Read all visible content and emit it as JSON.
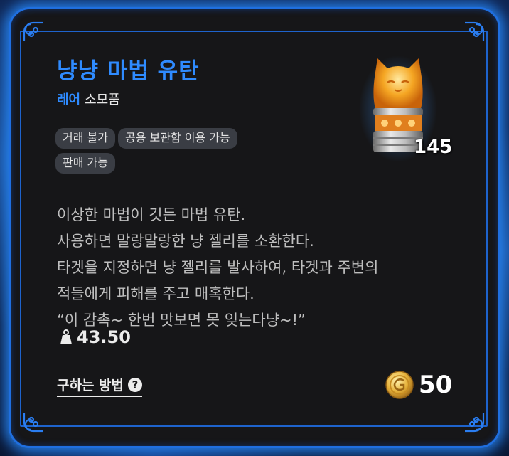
{
  "item": {
    "name": "냥냥 마법 유탄",
    "rarity": "레어",
    "category": "소모품",
    "count": "145",
    "icon": "cat-jelly-canister-icon"
  },
  "tags": [
    "거래 불가",
    "공용 보관함 이용 가능",
    "판매 가능"
  ],
  "description": [
    "이상한 마법이 깃든 마법 유탄.",
    "사용하면 말랑말랑한 냥 젤리를 소환한다.",
    "타겟을 지정하면 냥 젤리를 발사하여, 타겟과 주변의",
    "적들에게 피해를 주고 매혹한다.",
    "“이 감촉~ 한번 맛보면 못 잊는다냥~!”"
  ],
  "weight": "43.50",
  "how_to_obtain": "구하는 방법",
  "help_icon_glyph": "?",
  "price": "50",
  "colors": {
    "accent": "#2f8bff",
    "frame": "#1f6fe0",
    "panel": "#161618"
  }
}
